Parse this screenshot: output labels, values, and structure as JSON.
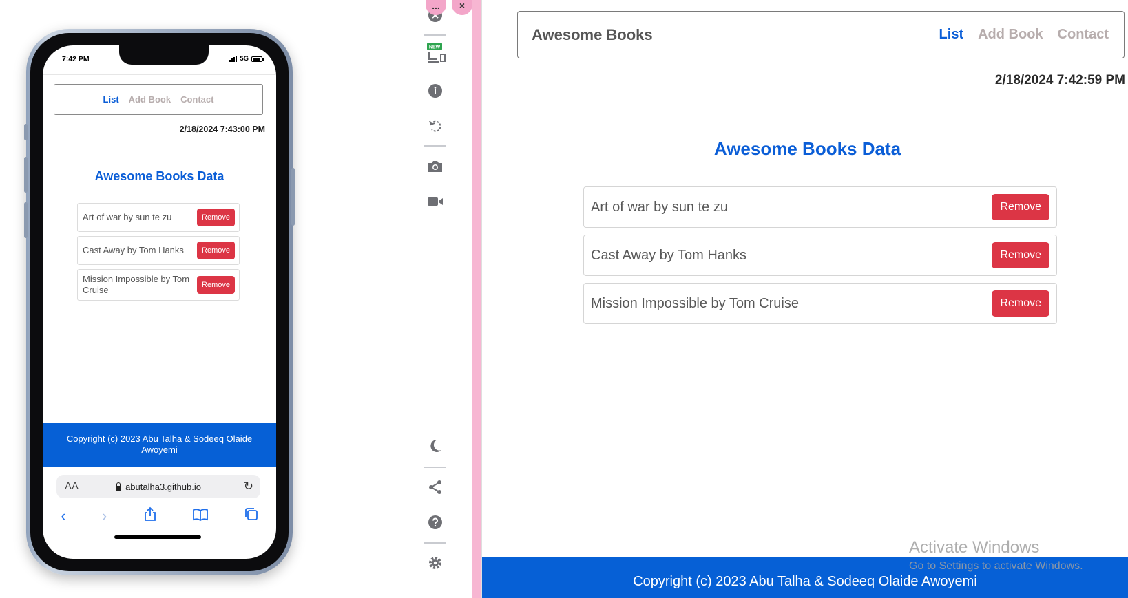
{
  "mobile": {
    "status_time": "7:42 PM",
    "network": "5G",
    "nav": {
      "list": "List",
      "add_book": "Add Book",
      "contact": "Contact"
    },
    "date": "2/18/2024 7:43:00 PM",
    "heading": "Awesome Books Data",
    "books": [
      {
        "title": "Art of war by sun te zu",
        "remove": "Remove"
      },
      {
        "title": "Cast Away by Tom Hanks",
        "remove": "Remove"
      },
      {
        "title": "Mission Impossible by Tom Cruise",
        "remove": "Remove"
      }
    ],
    "footer": "Copyright (c) 2023 Abu Talha & Sodeeq Olaide Awoyemi",
    "url_bar": {
      "text_size": "AA",
      "host": "abutalha3.github.io"
    }
  },
  "rail": {
    "icons": [
      "close-icon",
      "new-devices-icon",
      "info-icon",
      "rotate-icon",
      "camera-icon",
      "video-icon",
      "moon-icon",
      "share-icon",
      "help-icon",
      "settings-icon"
    ],
    "new_badge": "NEW",
    "pink_controls": [
      "...",
      "×"
    ]
  },
  "desktop": {
    "brand": "Awesome Books",
    "nav": {
      "list": "List",
      "add_book": "Add Book",
      "contact": "Contact"
    },
    "date": "2/18/2024 7:42:59 PM",
    "heading": "Awesome Books Data",
    "books": [
      {
        "title": "Art of war by sun te zu",
        "remove": "Remove"
      },
      {
        "title": "Cast Away by Tom Hanks",
        "remove": "Remove"
      },
      {
        "title": "Mission Impossible by Tom Cruise",
        "remove": "Remove"
      }
    ],
    "footer": "Copyright (c) 2023 Abu Talha & Sodeeq Olaide Awoyemi"
  },
  "watermark": {
    "line1": "Activate Windows",
    "line2": "Go to Settings to activate Windows."
  },
  "colors": {
    "accent": "#0b5ed7",
    "remove_button": "#dc3545",
    "footer": "#0660d6",
    "inactive_link": "#b7adad",
    "divider_pink": "#f7b6d2"
  }
}
